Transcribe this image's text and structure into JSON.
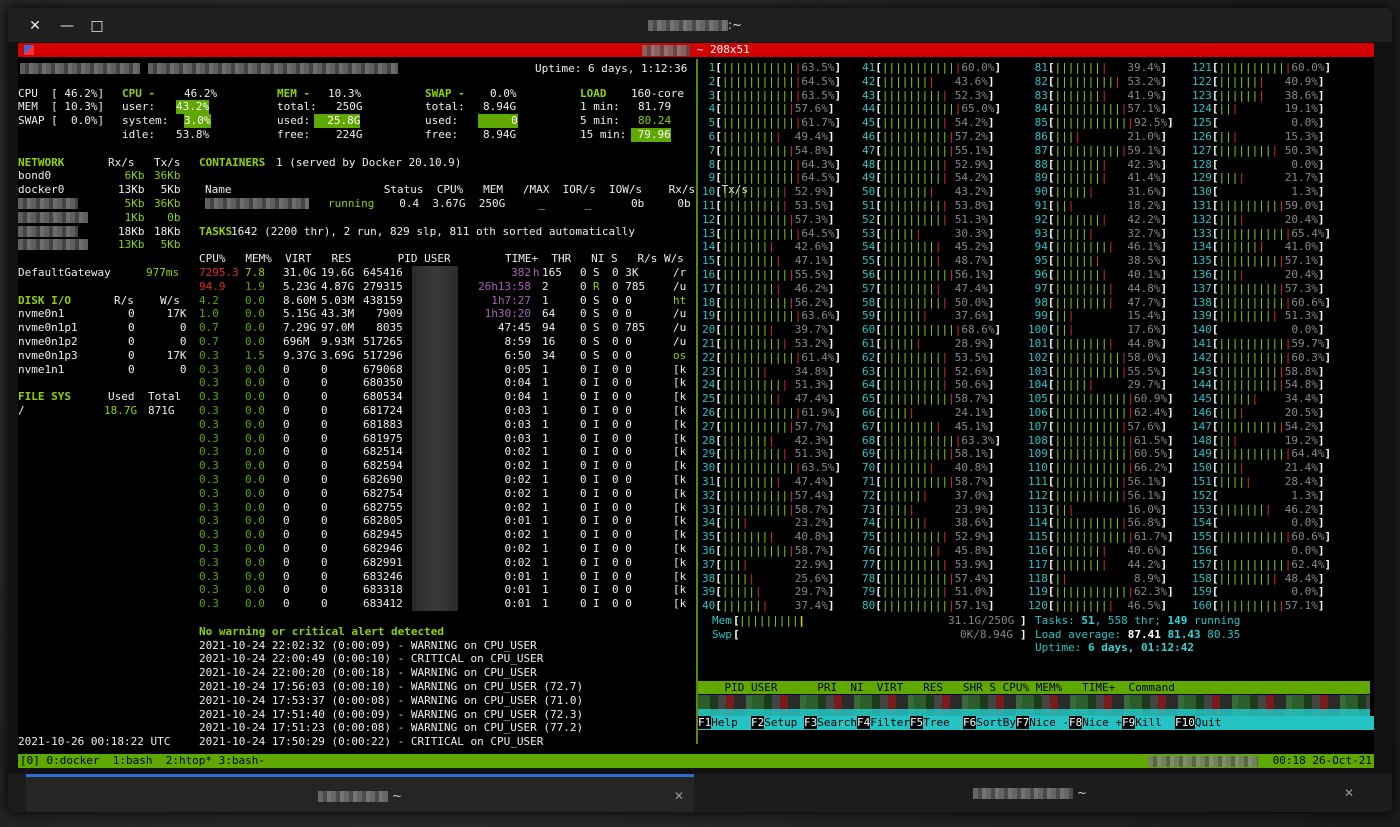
{
  "window": {
    "title_suffix": ":~",
    "close": "✕",
    "minimize": "—",
    "maximize": "□"
  },
  "tmux": {
    "size": "~ 208x51",
    "status_windows": "[0] 0:docker  1:bash  2:htop* 3:bash-",
    "status_time": "00:18 26-Oct-21"
  },
  "glances": {
    "uptime": "Uptime: 6 days, 1:12:36",
    "quick": [
      "CPU  [ 46.2%]",
      "MEM  [ 10.3%]",
      "SWAP [  0.0%]"
    ],
    "cpu": {
      "label": "CPU -",
      "total": "46.2%",
      "user_l": "user:",
      "user": "43.2%",
      "system_l": "system:",
      "system": "3.0%",
      "idle_l": "idle:",
      "idle": "53.8%"
    },
    "mem": {
      "label": "MEM -",
      "pct": "10.3%",
      "total_l": "total:",
      "total": "250G",
      "used_l": "used:",
      "used": "25.8G",
      "free_l": "free:",
      "free": "224G"
    },
    "swap": {
      "label": "SWAP -",
      "pct": "0.0%",
      "total_l": "total:",
      "total": "8.94G",
      "used_l": "used:",
      "used": "0",
      "free_l": "free:",
      "free": "8.94G"
    },
    "load": {
      "label": "LOAD",
      "cores": "160-core",
      "m1_l": "1 min:",
      "m1": "81.79",
      "m5_l": "5 min:",
      "m5": "80.24",
      "m15_l": "15 min:",
      "m15": "79.96"
    },
    "network": {
      "title": "NETWORK",
      "rx": "Rx/s",
      "tx": "Tx/s",
      "rows": [
        [
          "bond0",
          "6Kb",
          "36Kb"
        ],
        [
          "docker0",
          "13Kb",
          "5Kb"
        ],
        [
          "",
          "5Kb",
          "36Kb"
        ],
        [
          "",
          "1Kb",
          "0b"
        ],
        [
          "",
          "18Kb",
          "18Kb"
        ],
        [
          "",
          "13Kb",
          "5Kb"
        ]
      ],
      "gateway": "DefaultGateway",
      "gateway_ms": "977ms"
    },
    "disk": {
      "title": "DISK I/O",
      "r": "R/s",
      "w": "W/s",
      "rows": [
        [
          "nvme0n1",
          "0",
          "17K"
        ],
        [
          "nvme0n1p1",
          "0",
          "0"
        ],
        [
          "nvme0n1p2",
          "0",
          "0"
        ],
        [
          "nvme0n1p3",
          "0",
          "17K"
        ],
        [
          "nvme1n1",
          "0",
          "0"
        ]
      ]
    },
    "fs": {
      "title": "FILE SYS",
      "used": "Used",
      "total": "Total",
      "rows": [
        [
          "/",
          "18.7G",
          "871G"
        ]
      ]
    },
    "containers": {
      "title": "CONTAINERS",
      "desc": "1 (served by Docker 20.10.9)",
      "header": "Name                       Status  CPU%   MEM   /MAX  IOR/s  IOW/s    Rx/s    Tx/s",
      "status": "running",
      "row": "  0.4  3.67G  250G     _      _      0b     0b"
    },
    "tasks": {
      "label": "TASKS",
      "text": "1642 (2200 thr), 2 run, 829 slp, 811 oth sorted automatically"
    },
    "proc_header": "CPU%   MEM%  VIRT   RES       PID USER",
    "proc_header2": "TIME+  THR   NI S   R/s W/s",
    "procs": [
      [
        "7295.3",
        "7.8",
        "31.0G",
        "19.6G",
        "645416",
        "382",
        "h",
        "165",
        "0",
        "S",
        "0 3K",
        "/r"
      ],
      [
        "94.9",
        "1.9",
        "5.23G",
        "4.87G",
        "279315",
        "26h13:58",
        "",
        "2",
        "0",
        "R",
        "0 785",
        "/u"
      ],
      [
        "4.2",
        "0.0",
        "8.60M",
        "5.03M",
        "438159",
        "1h7:27",
        "",
        "1",
        "0",
        "S",
        "0 0",
        "ht"
      ],
      [
        "1.0",
        "0.0",
        "5.15G",
        "43.3M",
        "7909",
        "1h30:20",
        "",
        "64",
        "0",
        "S",
        "0 0",
        "/u"
      ],
      [
        "0.7",
        "0.0",
        "7.29G",
        "97.0M",
        "8035",
        "47:45",
        "",
        "94",
        "0",
        "S",
        "0 785",
        "/u"
      ],
      [
        "0.7",
        "0.0",
        "696M",
        "9.93M",
        "517265",
        "8:59",
        "",
        "16",
        "0",
        "S",
        "0 0",
        "/u"
      ],
      [
        "0.3",
        "1.5",
        "9.37G",
        "3.69G",
        "517296",
        "6:50",
        "",
        "34",
        "0",
        "S",
        "0 0",
        "os"
      ],
      [
        "0.3",
        "0.0",
        "0",
        "0",
        "679068",
        "0:05",
        "",
        "1",
        "0",
        "I",
        "0 0",
        "[k"
      ],
      [
        "0.3",
        "0.0",
        "0",
        "0",
        "680350",
        "0:04",
        "",
        "1",
        "0",
        "I",
        "0 0",
        "[k"
      ],
      [
        "0.3",
        "0.0",
        "0",
        "0",
        "680534",
        "0:04",
        "",
        "1",
        "0",
        "I",
        "0 0",
        "[k"
      ],
      [
        "0.3",
        "0.0",
        "0",
        "0",
        "681724",
        "0:03",
        "",
        "1",
        "0",
        "I",
        "0 0",
        "[k"
      ],
      [
        "0.3",
        "0.0",
        "0",
        "0",
        "681883",
        "0:03",
        "",
        "1",
        "0",
        "I",
        "0 0",
        "[k"
      ],
      [
        "0.3",
        "0.0",
        "0",
        "0",
        "681975",
        "0:03",
        "",
        "1",
        "0",
        "I",
        "0 0",
        "[k"
      ],
      [
        "0.3",
        "0.0",
        "0",
        "0",
        "682514",
        "0:02",
        "",
        "1",
        "0",
        "I",
        "0 0",
        "[k"
      ],
      [
        "0.3",
        "0.0",
        "0",
        "0",
        "682594",
        "0:02",
        "",
        "1",
        "0",
        "I",
        "0 0",
        "[k"
      ],
      [
        "0.3",
        "0.0",
        "0",
        "0",
        "682690",
        "0:02",
        "",
        "1",
        "0",
        "I",
        "0 0",
        "[k"
      ],
      [
        "0.3",
        "0.0",
        "0",
        "0",
        "682754",
        "0:02",
        "",
        "1",
        "0",
        "I",
        "0 0",
        "[k"
      ],
      [
        "0.3",
        "0.0",
        "0",
        "0",
        "682755",
        "0:02",
        "",
        "1",
        "0",
        "I",
        "0 0",
        "[k"
      ],
      [
        "0.3",
        "0.0",
        "0",
        "0",
        "682805",
        "0:01",
        "",
        "1",
        "0",
        "I",
        "0 0",
        "[k"
      ],
      [
        "0.3",
        "0.0",
        "0",
        "0",
        "682945",
        "0:02",
        "",
        "1",
        "0",
        "I",
        "0 0",
        "[k"
      ],
      [
        "0.3",
        "0.0",
        "0",
        "0",
        "682946",
        "0:02",
        "",
        "1",
        "0",
        "I",
        "0 0",
        "[k"
      ],
      [
        "0.3",
        "0.0",
        "0",
        "0",
        "682991",
        "0:02",
        "",
        "1",
        "0",
        "I",
        "0 0",
        "[k"
      ],
      [
        "0.3",
        "0.0",
        "0",
        "0",
        "683246",
        "0:01",
        "",
        "1",
        "0",
        "I",
        "0 0",
        "[k"
      ],
      [
        "0.3",
        "0.0",
        "0",
        "0",
        "683318",
        "0:01",
        "",
        "1",
        "0",
        "I",
        "0 0",
        "[k"
      ],
      [
        "0.3",
        "0.0",
        "0",
        "0",
        "683412",
        "0:01",
        "",
        "1",
        "0",
        "I",
        "0 0",
        "[k"
      ]
    ],
    "alert_title": "No warning or critical alert detected",
    "alerts": [
      "2021-10-24 22:02:32 (0:00:09) - WARNING on CPU_USER",
      "2021-10-24 22:00:49 (0:00:10) - CRITICAL on CPU_USER",
      "2021-10-24 22:00:20 (0:00:18) - WARNING on CPU_USER",
      "2021-10-24 17:56:03 (0:00:10) - WARNING on CPU_USER (72.7)",
      "2021-10-24 17:53:37 (0:00:08) - WARNING on CPU_USER (71.0)",
      "2021-10-24 17:51:40 (0:00:09) - WARNING on CPU_USER (72.3)",
      "2021-10-24 17:51:23 (0:00:08) - WARNING on CPU_USER (77.2)",
      "2021-10-24 17:50:29 (0:00:22) - CRITICAL on CPU_USER"
    ],
    "datetime": "2021-10-26 00:18:22 UTC"
  },
  "htop": {
    "cpus": [
      [
        "1",
        "63.5%"
      ],
      [
        "2",
        "64.5%"
      ],
      [
        "3",
        "63.5%"
      ],
      [
        "4",
        "57.6%"
      ],
      [
        "5",
        "61.7%"
      ],
      [
        "6",
        "49.4%"
      ],
      [
        "7",
        "54.8%"
      ],
      [
        "8",
        "64.3%"
      ],
      [
        "9",
        "64.5%"
      ],
      [
        "10",
        "52.9%"
      ],
      [
        "11",
        "53.5%"
      ],
      [
        "12",
        "57.3%"
      ],
      [
        "13",
        "64.5%"
      ],
      [
        "14",
        "42.6%"
      ],
      [
        "15",
        "47.1%"
      ],
      [
        "16",
        "55.5%"
      ],
      [
        "17",
        "46.2%"
      ],
      [
        "18",
        "56.2%"
      ],
      [
        "19",
        "63.6%"
      ],
      [
        "20",
        "39.7%"
      ],
      [
        "21",
        "53.2%"
      ],
      [
        "22",
        "61.4%"
      ],
      [
        "23",
        "34.8%"
      ],
      [
        "24",
        "51.3%"
      ],
      [
        "25",
        "47.4%"
      ],
      [
        "26",
        "61.9%"
      ],
      [
        "27",
        "57.7%"
      ],
      [
        "28",
        "42.3%"
      ],
      [
        "29",
        "51.3%"
      ],
      [
        "30",
        "63.5%"
      ],
      [
        "31",
        "47.4%"
      ],
      [
        "32",
        "57.4%"
      ],
      [
        "33",
        "58.7%"
      ],
      [
        "34",
        "23.2%"
      ],
      [
        "35",
        "40.8%"
      ],
      [
        "36",
        "58.7%"
      ],
      [
        "37",
        "22.9%"
      ],
      [
        "38",
        "25.6%"
      ],
      [
        "39",
        "29.7%"
      ],
      [
        "40",
        "37.4%"
      ],
      [
        "41",
        "60.0%"
      ],
      [
        "42",
        "43.6%"
      ],
      [
        "43",
        "52.3%"
      ],
      [
        "44",
        "65.0%"
      ],
      [
        "45",
        "54.2%"
      ],
      [
        "46",
        "57.2%"
      ],
      [
        "47",
        "55.1%"
      ],
      [
        "48",
        "52.9%"
      ],
      [
        "49",
        "54.2%"
      ],
      [
        "50",
        "43.2%"
      ],
      [
        "51",
        "53.8%"
      ],
      [
        "52",
        "51.3%"
      ],
      [
        "53",
        "30.3%"
      ],
      [
        "54",
        "45.2%"
      ],
      [
        "55",
        "48.7%"
      ],
      [
        "56",
        "56.1%"
      ],
      [
        "57",
        "47.4%"
      ],
      [
        "58",
        "50.0%"
      ],
      [
        "59",
        "37.6%"
      ],
      [
        "60",
        "68.6%"
      ],
      [
        "61",
        "28.9%"
      ],
      [
        "62",
        "53.5%"
      ],
      [
        "63",
        "52.6%"
      ],
      [
        "64",
        "50.6%"
      ],
      [
        "65",
        "58.7%"
      ],
      [
        "66",
        "24.1%"
      ],
      [
        "67",
        "45.1%"
      ],
      [
        "68",
        "63.3%"
      ],
      [
        "69",
        "58.1%"
      ],
      [
        "70",
        "40.8%"
      ],
      [
        "71",
        "58.7%"
      ],
      [
        "72",
        "37.0%"
      ],
      [
        "73",
        "23.9%"
      ],
      [
        "74",
        "38.6%"
      ],
      [
        "75",
        "52.9%"
      ],
      [
        "76",
        "45.8%"
      ],
      [
        "77",
        "53.9%"
      ],
      [
        "78",
        "57.4%"
      ],
      [
        "79",
        "51.0%"
      ],
      [
        "80",
        "57.1%"
      ],
      [
        "81",
        "39.4%"
      ],
      [
        "82",
        "53.2%"
      ],
      [
        "83",
        "41.9%"
      ],
      [
        "84",
        "57.1%"
      ],
      [
        "85",
        "92.5%"
      ],
      [
        "86",
        "21.0%"
      ],
      [
        "87",
        "59.1%"
      ],
      [
        "88",
        "42.3%"
      ],
      [
        "89",
        "41.4%"
      ],
      [
        "90",
        "31.6%"
      ],
      [
        "91",
        "18.2%"
      ],
      [
        "92",
        "42.2%"
      ],
      [
        "93",
        "32.7%"
      ],
      [
        "94",
        "46.1%"
      ],
      [
        "95",
        "38.5%"
      ],
      [
        "96",
        "40.1%"
      ],
      [
        "97",
        "44.8%"
      ],
      [
        "98",
        "47.7%"
      ],
      [
        "99",
        "15.4%"
      ],
      [
        "100",
        "17.6%"
      ],
      [
        "101",
        "44.8%"
      ],
      [
        "102",
        "58.0%"
      ],
      [
        "103",
        "55.5%"
      ],
      [
        "104",
        "29.7%"
      ],
      [
        "105",
        "60.9%"
      ],
      [
        "106",
        "62.4%"
      ],
      [
        "107",
        "57.6%"
      ],
      [
        "108",
        "61.5%"
      ],
      [
        "109",
        "60.5%"
      ],
      [
        "110",
        "66.2%"
      ],
      [
        "111",
        "56.1%"
      ],
      [
        "112",
        "56.1%"
      ],
      [
        "113",
        "16.0%"
      ],
      [
        "114",
        "56.8%"
      ],
      [
        "115",
        "61.7%"
      ],
      [
        "116",
        "40.6%"
      ],
      [
        "117",
        "44.2%"
      ],
      [
        "118",
        "8.9%"
      ],
      [
        "119",
        "62.3%"
      ],
      [
        "120",
        "46.5%"
      ],
      [
        "121",
        "60.0%"
      ],
      [
        "122",
        "40.9%"
      ],
      [
        "123",
        "38.6%"
      ],
      [
        "124",
        "19.1%"
      ],
      [
        "125",
        "0.0%"
      ],
      [
        "126",
        "15.3%"
      ],
      [
        "127",
        "50.3%"
      ],
      [
        "128",
        "0.0%"
      ],
      [
        "129",
        "21.7%"
      ],
      [
        "130",
        "1.3%"
      ],
      [
        "131",
        "59.0%"
      ],
      [
        "132",
        "20.4%"
      ],
      [
        "133",
        "65.4%"
      ],
      [
        "134",
        "41.0%"
      ],
      [
        "135",
        "57.1%"
      ],
      [
        "136",
        "20.4%"
      ],
      [
        "137",
        "57.3%"
      ],
      [
        "138",
        "60.6%"
      ],
      [
        "139",
        "51.3%"
      ],
      [
        "140",
        "0.0%"
      ],
      [
        "141",
        "59.7%"
      ],
      [
        "142",
        "60.3%"
      ],
      [
        "143",
        "58.8%"
      ],
      [
        "144",
        "54.8%"
      ],
      [
        "145",
        "34.4%"
      ],
      [
        "146",
        "20.5%"
      ],
      [
        "147",
        "54.2%"
      ],
      [
        "148",
        "19.2%"
      ],
      [
        "149",
        "64.4%"
      ],
      [
        "150",
        "21.4%"
      ],
      [
        "151",
        "28.4%"
      ],
      [
        "152",
        "1.3%"
      ],
      [
        "153",
        "46.2%"
      ],
      [
        "154",
        "0.0%"
      ],
      [
        "155",
        "60.6%"
      ],
      [
        "156",
        "0.0%"
      ],
      [
        "157",
        "62.4%"
      ],
      [
        "158",
        "48.4%"
      ],
      [
        "159",
        "0.0%"
      ],
      [
        "160",
        "57.1%"
      ]
    ],
    "mem_label": "Mem",
    "mem_val": "31.1G/250G",
    "swp_label": "Swp",
    "swp_val": "0K/8.94G",
    "tasks": "Tasks: ",
    "tasks_n": "51",
    "tasks_thr": ", 558 thr; ",
    "tasks_run": "149",
    "tasks_r": " running",
    "load": "Load average: ",
    "load1": "87.41",
    "load5": "81.43",
    "load15": "80.35",
    "uptime": "Uptime: ",
    "uptime_val": "6 days, 01:12:42",
    "header": "    PID USER      PRI  NI  VIRT   RES   SHR S CPU% MEM%   TIME+  Command",
    "fkeys": [
      [
        "F1",
        "Help"
      ],
      [
        "F2",
        "Setup"
      ],
      [
        "F3",
        "Search"
      ],
      [
        "F4",
        "Filter"
      ],
      [
        "F5",
        "Tree"
      ],
      [
        "F6",
        "SortBy"
      ],
      [
        "F7",
        "Nice -"
      ],
      [
        "F8",
        "Nice +"
      ],
      [
        "F9",
        "Kill"
      ],
      [
        "F10",
        "Quit"
      ]
    ]
  },
  "tabs": [
    {
      "label": "~",
      "close": "✕"
    },
    {
      "label": "~",
      "close": "✕"
    }
  ]
}
